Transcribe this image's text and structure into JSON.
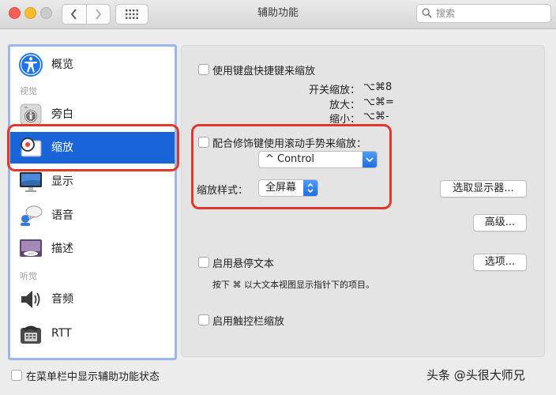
{
  "window": {
    "title": "辅助功能"
  },
  "search": {
    "placeholder": "搜索"
  },
  "sidebar": {
    "items": [
      {
        "label": "概览",
        "icon": "accessibility-icon"
      },
      {
        "label": "旁白",
        "icon": "voiceover-icon"
      },
      {
        "label": "缩放",
        "icon": "zoom-icon",
        "selected": true
      },
      {
        "label": "显示",
        "icon": "display-icon"
      },
      {
        "label": "语音",
        "icon": "speech-icon"
      },
      {
        "label": "描述",
        "icon": "descriptions-icon"
      },
      {
        "label": "音频",
        "icon": "audio-icon"
      },
      {
        "label": "RTT",
        "icon": "rtt-icon"
      }
    ],
    "sections": {
      "vision": "视觉",
      "hearing": "听觉"
    }
  },
  "zoom": {
    "keyboard_shortcuts_label": "使用键盘快捷键来缩放",
    "shortcuts": [
      {
        "label": "开关缩放：",
        "key": "⌥⌘8"
      },
      {
        "label": "放大：",
        "key": "⌥⌘="
      },
      {
        "label": "缩小：",
        "key": "⌥⌘-"
      }
    ],
    "scroll_gesture_label": "配合修饰键使用滚动手势来缩放：",
    "modifier_value": "^ Control",
    "style_label": "缩放样式：",
    "style_value": "全屏幕",
    "choose_display_button": "选取显示器...",
    "advanced_button": "高级...",
    "hover_text_label": "启用悬停文本",
    "options_button": "选项...",
    "hover_text_help": "按下 ⌘ 以大文本视图显示指针下的项目。",
    "touch_bar_label": "启用触控栏缩放"
  },
  "footer": {
    "menu_bar_status_label": "在菜单栏中显示辅助功能状态",
    "watermark": "头条 @头很大师兄"
  },
  "colors": {
    "selection": "#1964d8",
    "annotation_red": "#e2382b",
    "popup_blue": "#1f6fe0"
  }
}
